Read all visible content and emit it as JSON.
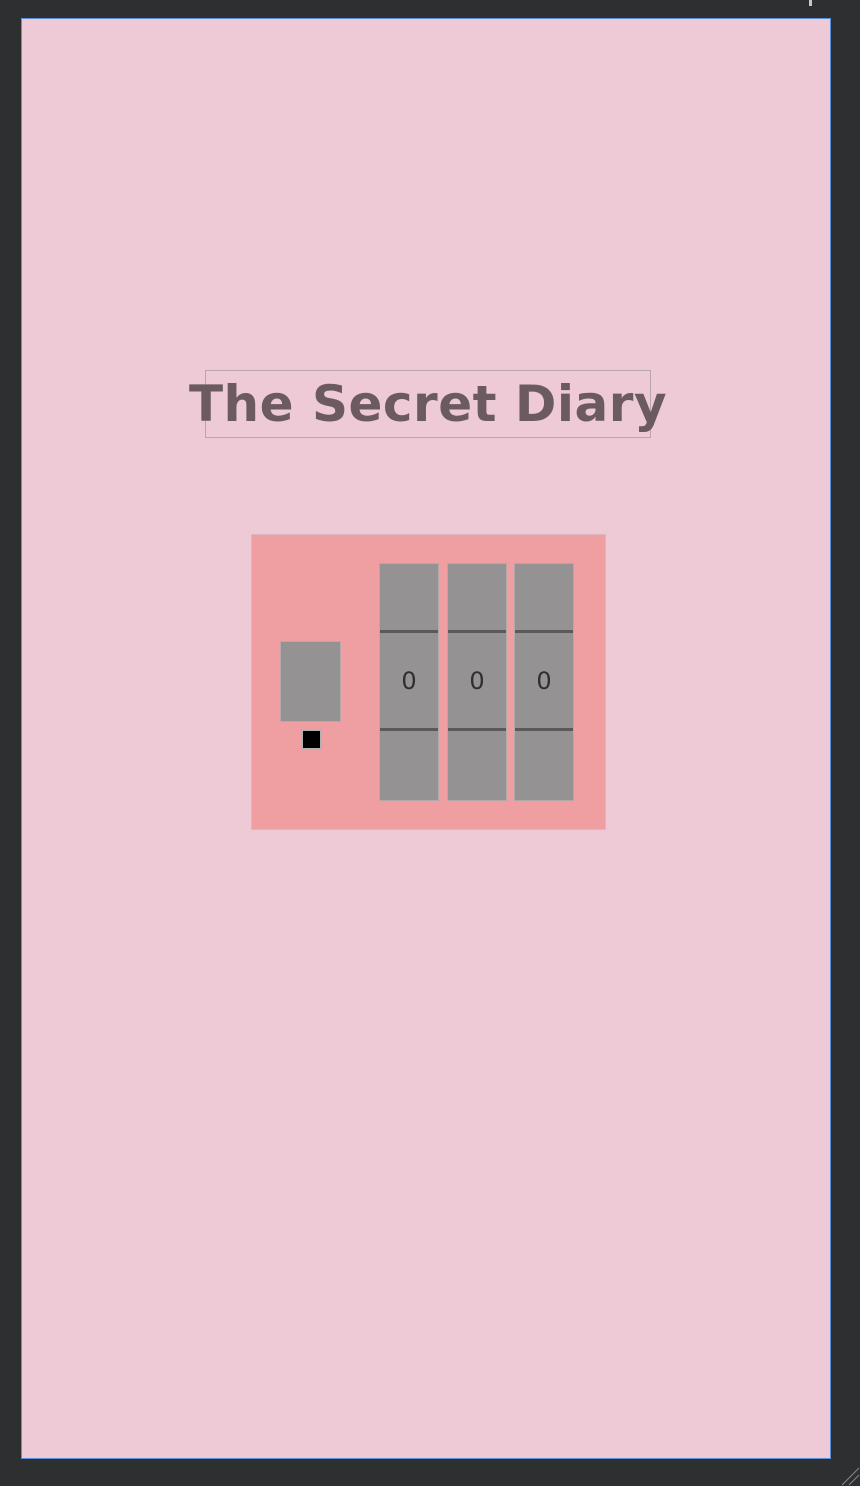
{
  "app": {
    "title": "The Secret Diary"
  },
  "lock": {
    "open_button_icon": "blank-button",
    "change_password_icon": "square-icon",
    "pickers": [
      {
        "value": "0"
      },
      {
        "value": "0"
      },
      {
        "value": "0"
      }
    ]
  },
  "colors": {
    "background": "#eec9d6",
    "title_text": "#6b5b61",
    "lock_panel": "#ef9fa2",
    "picker": "#959293",
    "frame_outer": "#2e2f31"
  }
}
